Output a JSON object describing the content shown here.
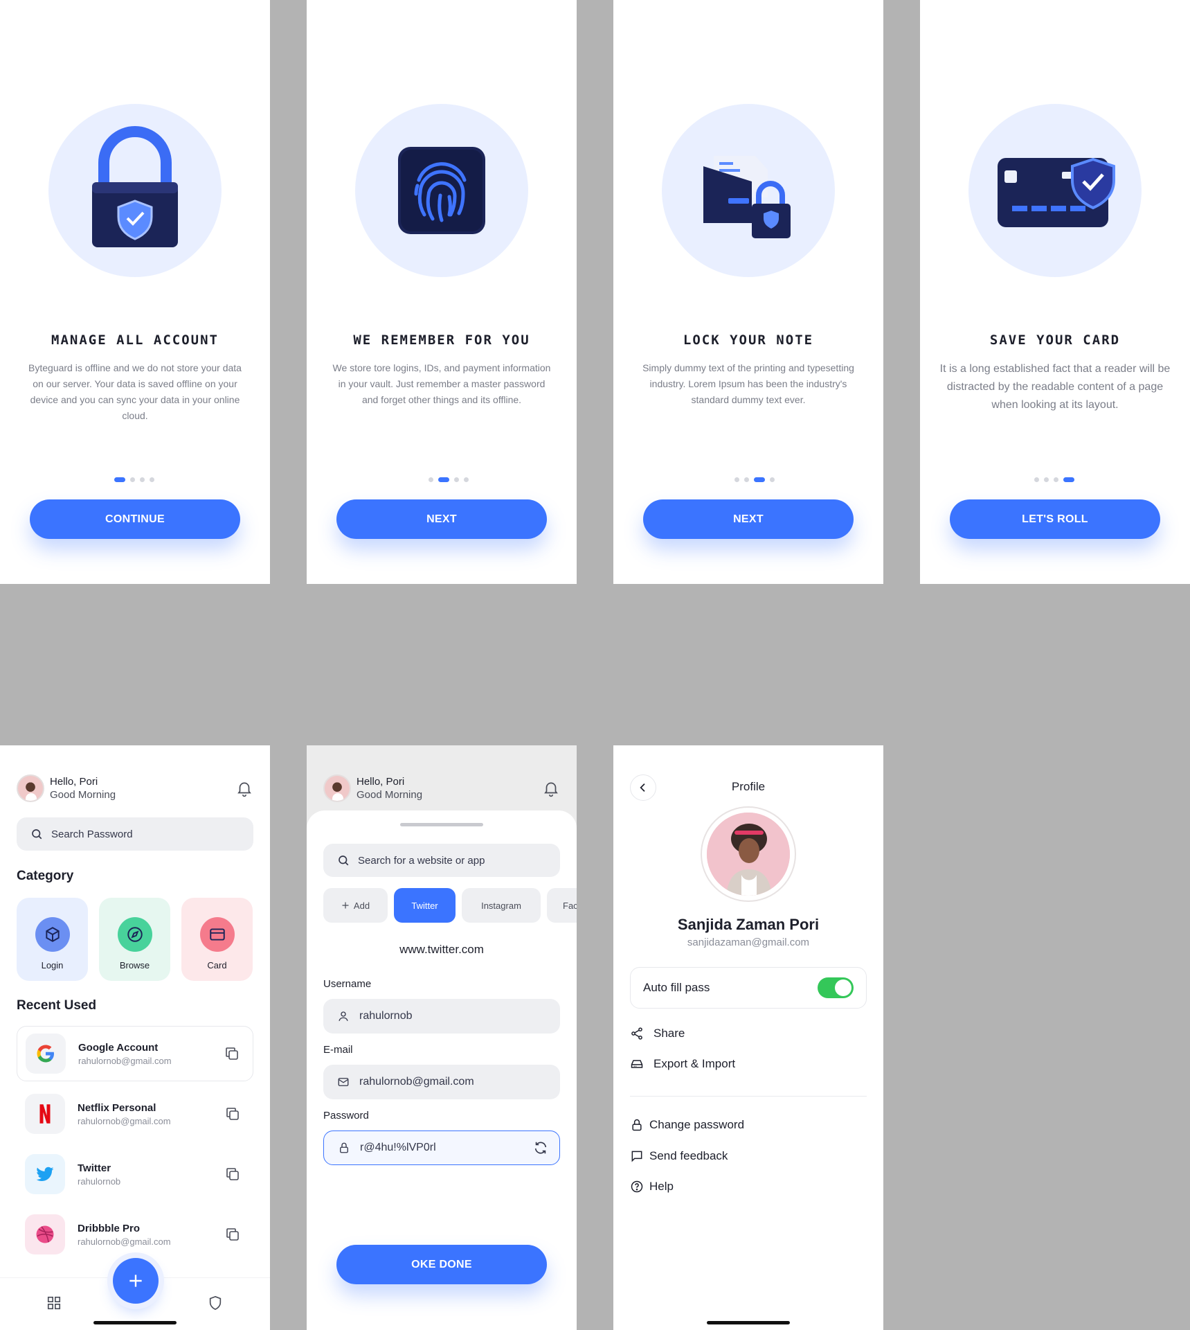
{
  "onboarding": [
    {
      "title": "MANAGE ALL ACCOUNT",
      "text": "Byteguard is offline and we do not store your data on our server. Your data is saved offline on your device and you can sync your data in your online cloud.",
      "button": "CONTINUE",
      "active_dot": 1
    },
    {
      "title": "WE REMEMBER FOR YOU",
      "text": "We store tore logins, IDs, and payment information in your vault. Just remember a master password and forget other things and its offline.",
      "button": "NEXT",
      "active_dot": 2
    },
    {
      "title": "LOCK YOUR NOTE",
      "text": "Simply dummy text of the printing and typesetting industry. Lorem Ipsum has been the industry's standard dummy text ever.",
      "button": "NEXT",
      "active_dot": 3
    },
    {
      "title": "SAVE YOUR CARD",
      "text": "It is a long established fact that a reader will be distracted by the readable content of a page when looking at its layout.",
      "button": "LET'S ROLL",
      "active_dot": 4
    }
  ],
  "header": {
    "hello": "Hello, Pori",
    "greeting": "Good Morning"
  },
  "home": {
    "search_placeholder": "Search Password",
    "category_title": "Category",
    "categories": [
      {
        "label": "Login",
        "icon": "box-icon"
      },
      {
        "label": "Browse",
        "icon": "compass-icon"
      },
      {
        "label": "Card",
        "icon": "card-icon"
      }
    ],
    "recent_title": "Recent Used",
    "recent": [
      {
        "name": "Google Account",
        "sub": "rahulornob@gmail.com",
        "icon": "google-icon"
      },
      {
        "name": "Netflix Personal",
        "sub": "rahulornob@gmail.com",
        "icon": "netflix-icon"
      },
      {
        "name": "Twitter",
        "sub": "rahulornob",
        "icon": "twitter-icon"
      },
      {
        "name": "Dribbble Pro",
        "sub": "rahulornob@gmail.com",
        "icon": "dribbble-icon"
      }
    ]
  },
  "add": {
    "search_placeholder": "Search for a website or app",
    "chips": [
      "Add",
      "Twitter",
      "Instagram",
      "Face"
    ],
    "site": "www.twitter.com",
    "username_label": "Username",
    "username": "rahulornob",
    "email_label": "E-mail",
    "email": "rahulornob@gmail.com",
    "password_label": "Password",
    "password": "r@4hu!%lVP0rl",
    "done_button": "OKE DONE"
  },
  "profile": {
    "title": "Profile",
    "name": "Sanjida Zaman Pori",
    "email": "sanjidazaman@gmail.com",
    "autofill_label": "Auto fill pass",
    "autofill_on": true,
    "menu_top": [
      {
        "label": "Share",
        "icon": "share-icon"
      },
      {
        "label": "Export & Import",
        "icon": "drive-icon"
      }
    ],
    "menu_bottom": [
      {
        "label": "Change password",
        "icon": "lock-icon"
      },
      {
        "label": "Send feedback",
        "icon": "message-icon"
      },
      {
        "label": "Help",
        "icon": "help-icon"
      }
    ]
  },
  "colors": {
    "accent": "#3b74ff",
    "toggle_on": "#34c759",
    "illustration_bg": "#e9efff"
  }
}
